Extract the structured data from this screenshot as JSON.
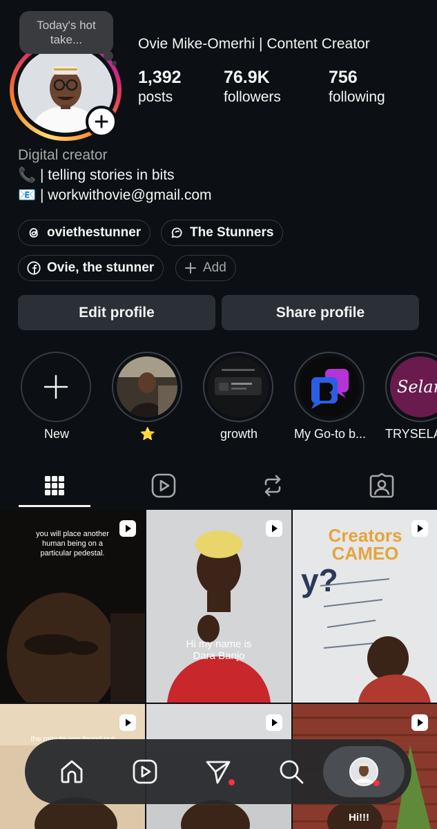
{
  "profile": {
    "note": "Today's hot take...",
    "name": "Ovie Mike-Omerhi | Content Creator",
    "stats": [
      {
        "value": "1,392",
        "label": "posts"
      },
      {
        "value": "76.9K",
        "label": "followers"
      },
      {
        "value": "756",
        "label": "following"
      }
    ],
    "category": "Digital creator",
    "bio_lines": [
      {
        "emoji": "📞",
        "text": " | telling stories in bits"
      },
      {
        "emoji": "📧",
        "text": " | workwithovie@gmail.com"
      }
    ]
  },
  "links": {
    "threads": "oviethestunner",
    "channel": "The Stunners",
    "facebook": "Ovie, the stunner",
    "add": "Add"
  },
  "actions": {
    "edit": "Edit profile",
    "share": "Share profile"
  },
  "highlights": [
    {
      "label": "New"
    },
    {
      "label": "⭐️"
    },
    {
      "label": "growth"
    },
    {
      "label": "My Go-to b..."
    },
    {
      "label": "TRYSELA",
      "logo_text": "Selan"
    }
  ],
  "tabs": [
    "posts-grid",
    "reels",
    "reposts",
    "tagged"
  ],
  "posts": [
    {
      "caption": "you will place another human being on a particular pedestal."
    },
    {
      "caption": "Hi my name is Dara Banjo"
    },
    {
      "caption": "Creators CAMEO"
    },
    {
      "caption": "the minute you found out"
    },
    {
      "caption": ""
    },
    {
      "caption": "Hi!!!"
    }
  ],
  "nav": [
    "home",
    "reels",
    "messages",
    "search",
    "profile"
  ],
  "colors": {
    "background": "#0c1014",
    "button": "#2b3036",
    "notification": "#ff3040",
    "muted_text": "#a8a8a8"
  }
}
